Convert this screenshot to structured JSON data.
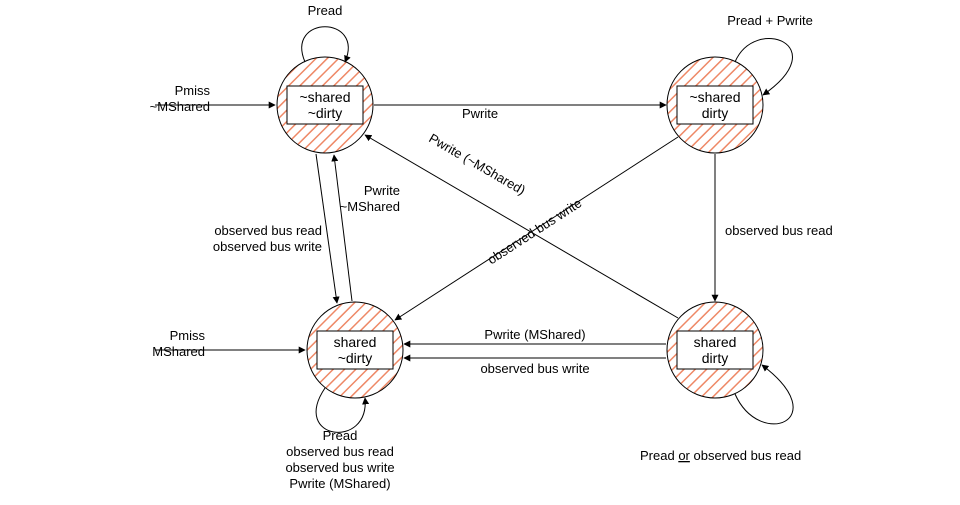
{
  "diagram": {
    "states": {
      "tl": {
        "line1": "~shared",
        "line2": "~dirty"
      },
      "tr": {
        "line1": "~shared",
        "line2": "dirty"
      },
      "bl": {
        "line1": "shared",
        "line2": "~dirty"
      },
      "br": {
        "line1": "shared",
        "line2": "dirty"
      }
    },
    "edges": {
      "tl_self": "Pread",
      "tr_self": "Pread + Pwrite",
      "bl_self_l1": "Pread",
      "bl_self_l2": "observed bus read",
      "bl_self_l3": "observed bus write",
      "bl_self_l4": "Pwrite (MShared)",
      "br_self": "Pread or observed bus read",
      "entry_tl_l1": "Pmiss",
      "entry_tl_l2": "~MShared",
      "entry_bl_l1": "Pmiss",
      "entry_bl_l2": "MShared",
      "tl_tr": "Pwrite",
      "tr_br": "observed bus read",
      "br_bl_l1": "Pwrite (MShared)",
      "br_bl_l2": "observed bus write",
      "bl_tl_l1": "Pwrite",
      "bl_tl_l2": "~MShared",
      "tl_bl_l1": "observed bus read",
      "tl_bl_l2": "observed bus write",
      "tr_bl": "observed bus write",
      "br_tl": "Pwrite (~MShared)"
    },
    "underline_word": "or"
  }
}
